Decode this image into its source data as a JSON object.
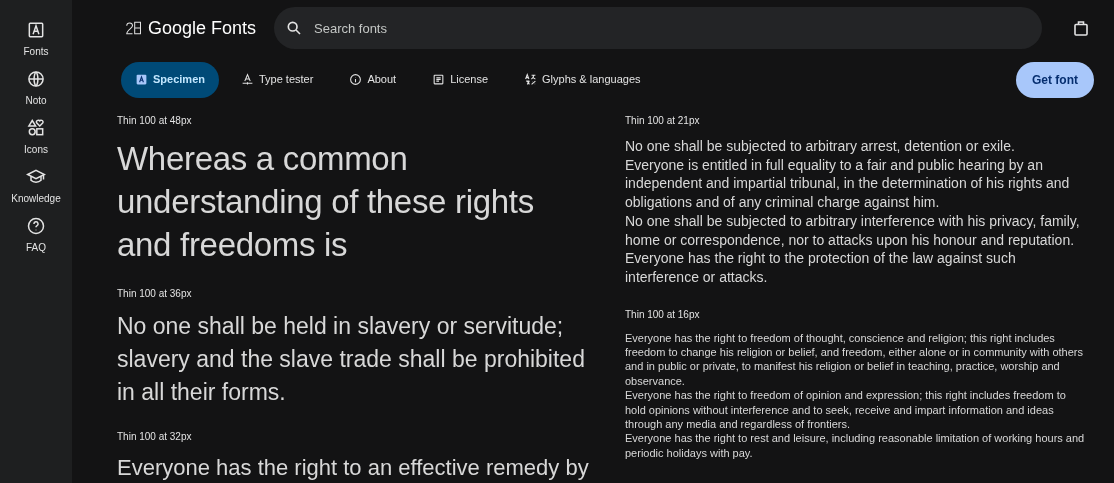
{
  "sidebar": {
    "items": [
      {
        "label": "Fonts"
      },
      {
        "label": "Noto"
      },
      {
        "label": "Icons"
      },
      {
        "label": "Knowledge"
      },
      {
        "label": "FAQ"
      }
    ]
  },
  "header": {
    "logo": "Google Fonts",
    "search": {
      "placeholder": "Search fonts"
    }
  },
  "tabs": [
    {
      "label": "Specimen",
      "selected": true
    },
    {
      "label": "Type tester",
      "selected": false
    },
    {
      "label": "About",
      "selected": false
    },
    {
      "label": "License",
      "selected": false
    },
    {
      "label": "Glyphs & languages",
      "selected": false
    }
  ],
  "get_font_button": "Get font",
  "left_samples": [
    {
      "label": "Thin 100 at 48px",
      "paragraphs": [
        "Whereas a common understanding of these rights and freedoms is"
      ]
    },
    {
      "label": "Thin 100 at 36px",
      "paragraphs": [
        "No one shall be held in slavery or servitude; slavery and the slave trade shall be prohibited in all their forms."
      ]
    },
    {
      "label": "Thin 100 at 32px",
      "paragraphs": [
        "Everyone has the right to an effective remedy by"
      ]
    }
  ],
  "right_samples": [
    {
      "label": "Thin 100 at 21px",
      "paragraphs": [
        "No one shall be subjected to arbitrary arrest, detention or exile.",
        "Everyone is entitled in full equality to a fair and public hearing by an independent and impartial tribunal, in the determination of his rights and obligations and of any criminal charge against him.",
        "No one shall be subjected to arbitrary interference with his privacy, family, home or correspondence, nor to attacks upon his honour and reputation. Everyone has the right to the protection of the law against such interference or attacks."
      ]
    },
    {
      "label": "Thin 100 at 16px",
      "paragraphs": [
        "Everyone has the right to freedom of thought, conscience and religion; this right includes freedom to change his religion or belief, and freedom, either alone or in community with others and in public or private, to manifest his religion or belief in teaching, practice, worship and observance.",
        "Everyone has the right to freedom of opinion and expression; this right includes freedom to hold opinions without interference and to seek, receive and impart information and ideas through any media and regardless of frontiers.",
        "Everyone has the right to rest and leisure, including reasonable limitation of working hours and periodic holidays with pay."
      ]
    }
  ]
}
